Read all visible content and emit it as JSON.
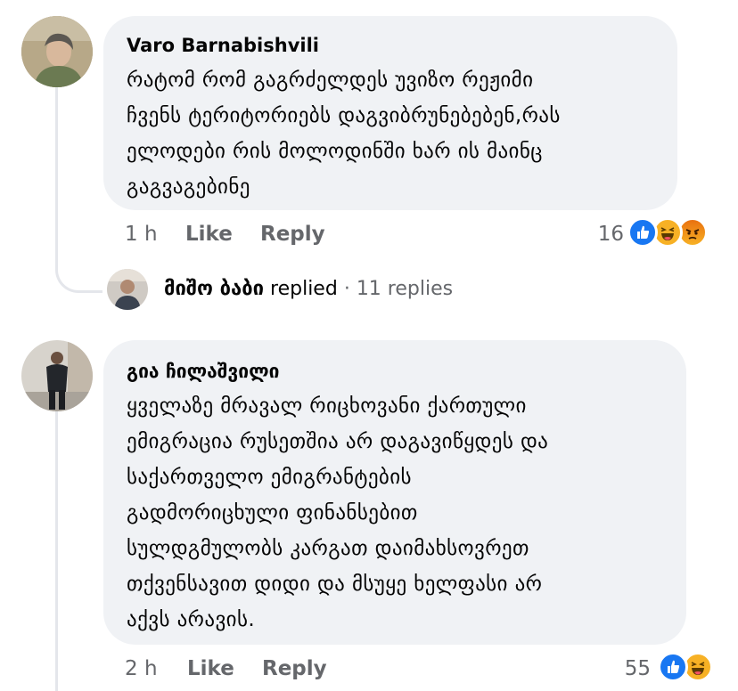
{
  "comments": [
    {
      "author": "Varo Barnabishvili",
      "lines": [
        "რატომ რომ გაგრძელდეს უვიზო რეჟიმი",
        "ჩვენს ტერიტორიებს დაგვიბრუნებებენ,რას",
        "ელოდები რის მოლოდინში ხარ ის მაინც",
        "გაგვაგებინე"
      ],
      "time": "1 h",
      "like_label": "Like",
      "reply_label": "Reply",
      "reaction_count": "16",
      "reactions": [
        "like-icon",
        "haha-icon",
        "angry-icon"
      ]
    },
    {
      "author": "გია ჩილაშვილი",
      "lines": [
        "ყველაზე მრავალ რიცხოვანი ქართული",
        "ემიგრაცია რუსეთშია არ დაგავიწყდეს და",
        "საქართველო ემიგრანტების",
        "გადმორიცხული ფინანსებით",
        "სულდგმულობს  კარგათ დაიმახსოვრეთ",
        "თქვენსავით დიდი და მსუყე ხელფასი არ",
        "აქვს არავის."
      ],
      "time": "2 h",
      "like_label": "Like",
      "reply_label": "Reply",
      "reaction_count": "55",
      "reactions": [
        "like-icon",
        "haha-icon"
      ]
    }
  ],
  "replies_preview": {
    "name": "მიშო ბაბი",
    "action": "replied",
    "separator": "·",
    "count_label": "11 replies"
  },
  "colors": {
    "bubble": "#f0f2f5",
    "meta_text": "#65676b",
    "like_blue": "#1877f2",
    "haha_yellow": "#f7b125",
    "angry_orange": "#e9710f"
  }
}
